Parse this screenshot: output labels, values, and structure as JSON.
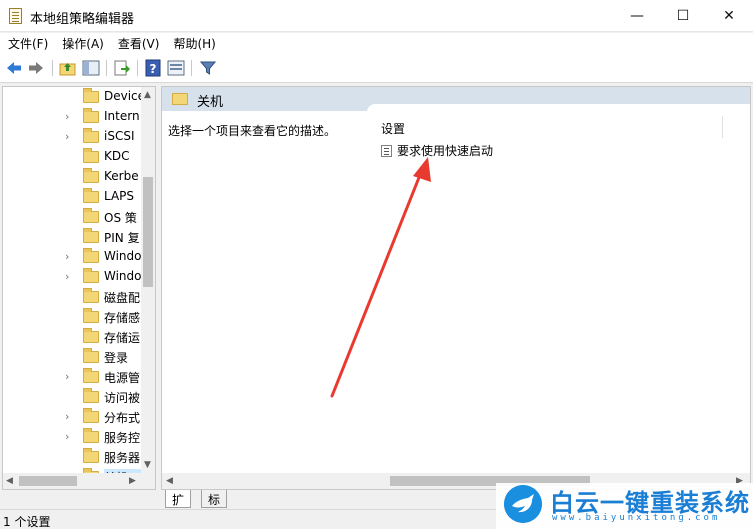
{
  "window": {
    "title": "本地组策略编辑器"
  },
  "menu": [
    {
      "label": "文件(F)"
    },
    {
      "label": "操作(A)"
    },
    {
      "label": "查看(V)"
    },
    {
      "label": "帮助(H)"
    }
  ],
  "tree": {
    "items": [
      {
        "label": "Device",
        "expandable": false
      },
      {
        "label": "Intern",
        "expandable": true
      },
      {
        "label": "iSCSI",
        "expandable": true
      },
      {
        "label": "KDC",
        "expandable": false
      },
      {
        "label": "Kerbe",
        "expandable": false
      },
      {
        "label": "LAPS",
        "expandable": false
      },
      {
        "label": "OS 策",
        "expandable": false
      },
      {
        "label": "PIN 复",
        "expandable": false
      },
      {
        "label": "Windo",
        "expandable": true
      },
      {
        "label": "Windo",
        "expandable": true
      },
      {
        "label": "磁盘配",
        "expandable": false
      },
      {
        "label": "存储感",
        "expandable": false
      },
      {
        "label": "存储运",
        "expandable": false
      },
      {
        "label": "登录",
        "expandable": false
      },
      {
        "label": "电源管",
        "expandable": true
      },
      {
        "label": "访问被",
        "expandable": false
      },
      {
        "label": "分布式",
        "expandable": true
      },
      {
        "label": "服务控",
        "expandable": true
      },
      {
        "label": "服务器",
        "expandable": false
      },
      {
        "label": "关机",
        "expandable": false,
        "selected": true
      }
    ]
  },
  "main": {
    "header_title": "关机",
    "description": "选择一个项目来查看它的描述。",
    "column_header": "设置",
    "items": [
      {
        "label": "要求使用快速启动"
      }
    ]
  },
  "tabs": [
    {
      "label": "扩展"
    },
    {
      "label": "标准"
    }
  ],
  "status": {
    "text": "1 个设置"
  },
  "watermark": {
    "brand": "白云一键重装系统",
    "url": "www.baiyunxitong.com"
  },
  "colors": {
    "header_band": "#d7e1ec",
    "selection": "#cce8ff",
    "annotation_arrow": "#e83a2e",
    "watermark": "#1a7fd4"
  }
}
